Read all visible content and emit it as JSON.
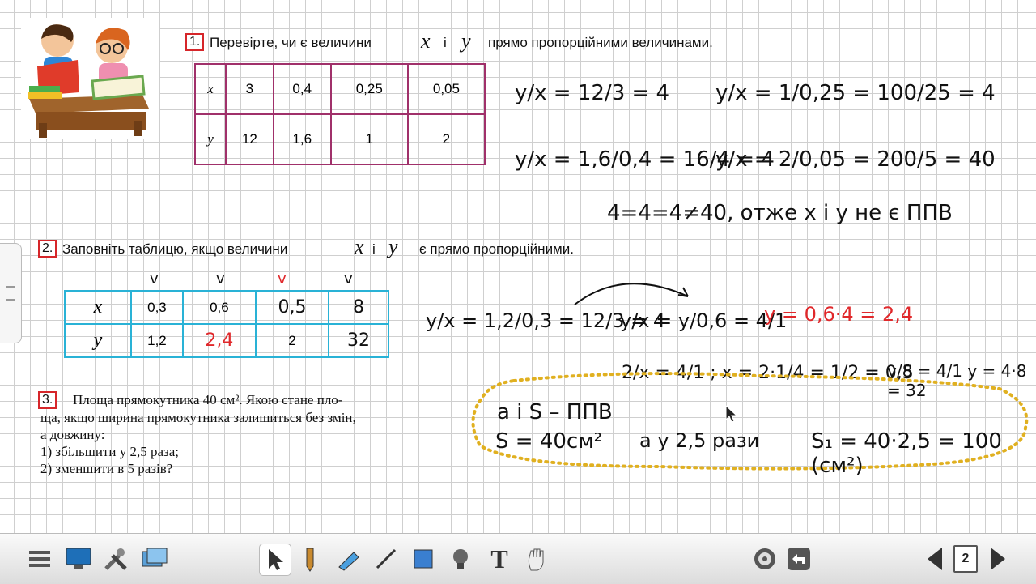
{
  "task1": {
    "number": "1.",
    "text_before": "Перевірте, чи є величини",
    "var_x": "x",
    "conj": "і",
    "var_y": "y",
    "text_after": "прямо пропорційними  величинами.",
    "table": {
      "row_x_label": "x",
      "row_y_label": "y",
      "x_values": [
        "3",
        "0,4",
        "0,25",
        "0,05"
      ],
      "y_values": [
        "12",
        "1,6",
        "1",
        "2"
      ]
    },
    "work": {
      "f1": "y/x = 12/3 = 4",
      "f2": "y/x = 1/0,25 = 100/25 = 4",
      "f3": "y/x = 1,6/0,4 = 16/4 = 4",
      "f4": "y/x = 2/0,05 = 200/5 = 40",
      "conclusion": "4=4=4≠40, отже x і y не є ППВ"
    }
  },
  "task2": {
    "number": "2.",
    "text_before": "Заповніть таблицю, якщо величини",
    "var_x": "x",
    "conj": "і",
    "var_y": "y",
    "text_after": "є прямо пропорційними.",
    "checks": [
      "v",
      "v",
      "v",
      "v"
    ],
    "table": {
      "row_x_label": "x",
      "row_y_label": "y",
      "x_values": [
        "0,3",
        "0,6",
        "0,5",
        "8"
      ],
      "y_values": [
        "1,2",
        "2,4",
        "2",
        "32"
      ]
    },
    "work": {
      "f1": "y/x = 1,2/0,3 = 12/3 = 4",
      "f2": "y/x = y/0,6 = 4/1",
      "red1": "y = 0,6·4 = 2,4",
      "f3": "2/x = 4/1 ;  x = 2·1/4 = 1/2 = 0,5",
      "f4": "y/8 = 4/1  y = 4·8 = 32"
    }
  },
  "task3": {
    "number": "3.",
    "lines": [
      "Площа прямокутника 40 см². Якою стане пло-",
      "ща, якщо ширина прямокутника залишиться без змін,",
      "а довжину:",
      "1) збільшити у 2,5 раза;",
      "2) зменшити в 5 разів?"
    ],
    "work": {
      "line1": "a  і  S  –  ППВ",
      "line2a": "S = 40см²",
      "line2b": "a у 2,5 рази",
      "line2c": "S₁ = 40·2,5 = 100 (см²)"
    }
  },
  "toolbar": {
    "icons": [
      "menu-icon",
      "monitor-icon",
      "tools-icon",
      "gallery-icon",
      "cursor-icon",
      "pencil-icon",
      "highlighter-icon",
      "line-icon",
      "shape-icon",
      "fill-icon",
      "text-icon",
      "hand-icon",
      "target-icon",
      "undo-icon",
      "prev-page-icon",
      "page-icon",
      "next-page-icon"
    ],
    "page_number": "2"
  },
  "colors": {
    "grid": "#cfcfcf",
    "table1_border": "#a0306a",
    "table2_border": "#29b2d6",
    "red_ink": "#e0282b",
    "dotted_outline": "#e0b020"
  }
}
